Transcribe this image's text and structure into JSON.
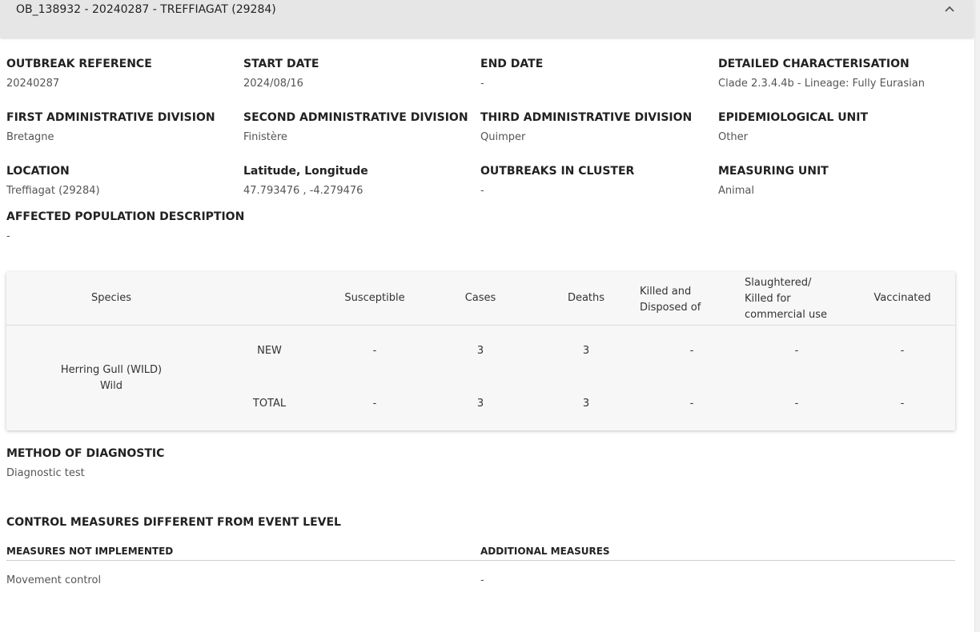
{
  "header": {
    "title": "OB_138932 - 20240287 - TREFFIAGAT (29284)"
  },
  "fields": {
    "outbreak_reference": {
      "label": "OUTBREAK REFERENCE",
      "value": "20240287"
    },
    "start_date": {
      "label": "START DATE",
      "value": "2024/08/16"
    },
    "end_date": {
      "label": "END DATE",
      "value": "-"
    },
    "detailed_characterisation": {
      "label": "DETAILED CHARACTERISATION",
      "value": "Clade 2.3.4.4b - Lineage: Fully Eurasian"
    },
    "first_admin": {
      "label": "FIRST ADMINISTRATIVE DIVISION",
      "value": "Bretagne"
    },
    "second_admin": {
      "label": "SECOND ADMINISTRATIVE DIVISION",
      "value": "Finistère"
    },
    "third_admin": {
      "label": "THIRD ADMINISTRATIVE DIVISION",
      "value": "Quimper"
    },
    "epi_unit": {
      "label": "EPIDEMIOLOGICAL UNIT",
      "value": "Other"
    },
    "location": {
      "label": "LOCATION",
      "value": "Treffiagat (29284)"
    },
    "lat_long": {
      "label": "Latitude, Longitude",
      "value": "47.793476 , -4.279476"
    },
    "outbreaks_cluster": {
      "label": "OUTBREAKS IN CLUSTER",
      "value": "-"
    },
    "measuring_unit": {
      "label": "MEASURING UNIT",
      "value": "Animal"
    },
    "affected_population": {
      "label": "AFFECTED POPULATION DESCRIPTION",
      "value": "-"
    }
  },
  "table": {
    "headers": {
      "species": "Species",
      "susceptible": "Susceptible",
      "cases": "Cases",
      "deaths": "Deaths",
      "killed": [
        "Killed and",
        "Disposed of"
      ],
      "slaughtered": [
        "Slaughtered/",
        "Killed for",
        "commercial use"
      ],
      "vaccinated": "Vaccinated"
    },
    "species_name": "Herring Gull (WILD)",
    "species_type": "Wild",
    "rows": [
      {
        "label": "NEW",
        "susceptible": "-",
        "cases": "3",
        "deaths": "3",
        "killed": "-",
        "slaughtered": "-",
        "vaccinated": "-"
      },
      {
        "label": "TOTAL",
        "susceptible": "-",
        "cases": "3",
        "deaths": "3",
        "killed": "-",
        "slaughtered": "-",
        "vaccinated": "-"
      }
    ]
  },
  "diagnostic": {
    "label": "METHOD OF DIAGNOSTIC",
    "value": "Diagnostic test"
  },
  "control": {
    "title": "CONTROL MEASURES DIFFERENT FROM EVENT LEVEL",
    "not_implemented_label": "MEASURES NOT IMPLEMENTED",
    "additional_label": "ADDITIONAL MEASURES",
    "not_implemented_value": "Movement control",
    "additional_value": "-"
  }
}
